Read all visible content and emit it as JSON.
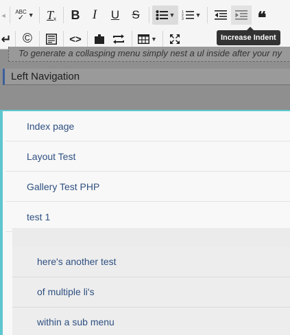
{
  "toolbar": {
    "row1": [
      {
        "name": "spellcheck-icon",
        "label": "ABC"
      },
      {
        "name": "remove-format-icon",
        "label": "T"
      },
      {
        "name": "bold-icon",
        "label": "B"
      },
      {
        "name": "italic-icon",
        "label": "I"
      },
      {
        "name": "underline-icon",
        "label": "U"
      },
      {
        "name": "strikethrough-icon",
        "label": "S"
      },
      {
        "name": "bullet-list-icon",
        "label": ""
      },
      {
        "name": "numbered-list-icon",
        "label": ""
      },
      {
        "name": "decrease-indent-icon",
        "label": ""
      },
      {
        "name": "increase-indent-icon",
        "label": ""
      },
      {
        "name": "blockquote-icon",
        "label": "66"
      }
    ],
    "row2": [
      {
        "name": "line-break-icon",
        "label": "↵"
      },
      {
        "name": "copyright-icon",
        "label": "©"
      },
      {
        "name": "template-icon",
        "label": ""
      },
      {
        "name": "source-code-icon",
        "label": "<>"
      },
      {
        "name": "plugin-icon",
        "label": ""
      },
      {
        "name": "swap-icon",
        "label": ""
      },
      {
        "name": "table-icon",
        "label": ""
      },
      {
        "name": "fullscreen-icon",
        "label": ""
      }
    ],
    "tooltip": "Increase Indent"
  },
  "editor": {
    "hint_text": "To generate a collasping menu simply nest a ul inside after your ny",
    "heading": "Left Navigation"
  },
  "menu": {
    "items": [
      {
        "label": "Index page"
      },
      {
        "label": "Layout Test"
      },
      {
        "label": "Gallery Test PHP"
      },
      {
        "label": "test 1"
      }
    ],
    "sub_items": [
      {
        "label": "here's another test"
      },
      {
        "label": "of multiple li's"
      },
      {
        "label": "within a sub menu"
      }
    ]
  },
  "colors": {
    "accent": "#5ec6cf",
    "link": "#2e4f80",
    "tooltip_bg": "#333333"
  }
}
